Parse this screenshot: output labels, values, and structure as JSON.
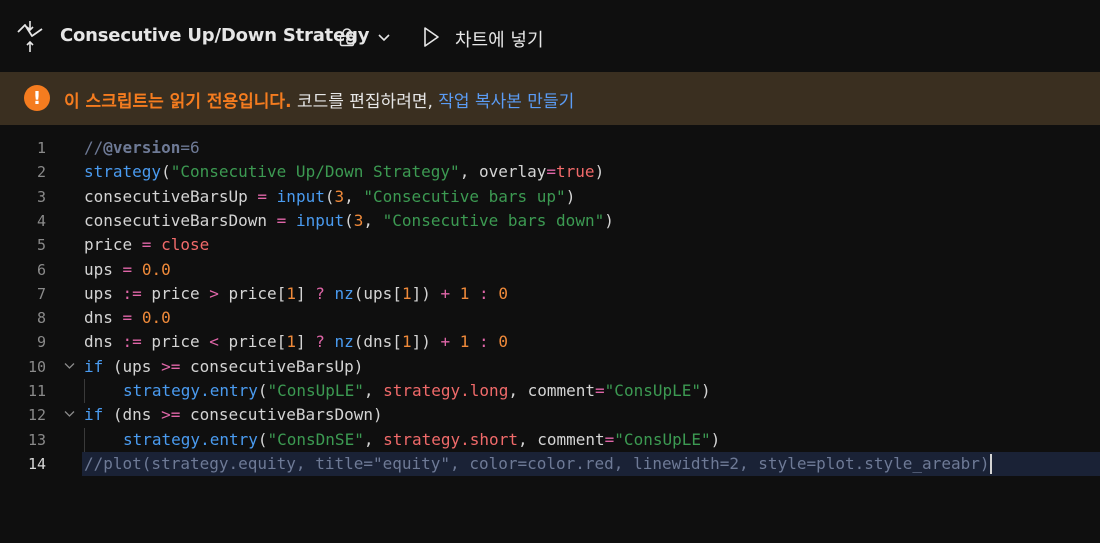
{
  "toolbar": {
    "script_title": "Consecutive Up/Down Strategy",
    "add_to_chart_label": "차트에 넣기",
    "icons": {
      "strategy": "strategy-icon",
      "lock": "lock-icon",
      "dropdown": "chevron-down-icon",
      "play": "play-icon"
    }
  },
  "banner": {
    "icon_glyph": "!",
    "readonly_text": "이 스크립트는 읽기 전용입니다.",
    "edit_text": " 코드를 편집하려면, ",
    "copy_link": "작업 복사본 만들기",
    "colors": {
      "warning": "#f57c1f",
      "link": "#5b9cf5",
      "background": "#3a2f20"
    }
  },
  "editor": {
    "current_line": 14,
    "lines": [
      {
        "n": "1",
        "tokens": [
          [
            "t-cm",
            "//"
          ],
          [
            "t-cmb",
            "@version"
          ],
          [
            "t-cm",
            "=6"
          ]
        ]
      },
      {
        "n": "2",
        "tokens": [
          [
            "t-fn",
            "strategy"
          ],
          [
            "t-var",
            "("
          ],
          [
            "t-str",
            "\"Consecutive Up/Down Strategy\""
          ],
          [
            "t-var",
            ", overlay"
          ],
          [
            "t-op",
            "="
          ],
          [
            "t-bi",
            "true"
          ],
          [
            "t-var",
            ")"
          ]
        ]
      },
      {
        "n": "3",
        "tokens": [
          [
            "t-var",
            "consecutiveBarsUp "
          ],
          [
            "t-op",
            "="
          ],
          [
            "t-var",
            " "
          ],
          [
            "t-fn",
            "input"
          ],
          [
            "t-var",
            "("
          ],
          [
            "t-num",
            "3"
          ],
          [
            "t-var",
            ", "
          ],
          [
            "t-str",
            "\"Consecutive bars up\""
          ],
          [
            "t-var",
            ")"
          ]
        ]
      },
      {
        "n": "4",
        "tokens": [
          [
            "t-var",
            "consecutiveBarsDown "
          ],
          [
            "t-op",
            "="
          ],
          [
            "t-var",
            " "
          ],
          [
            "t-fn",
            "input"
          ],
          [
            "t-var",
            "("
          ],
          [
            "t-num",
            "3"
          ],
          [
            "t-var",
            ", "
          ],
          [
            "t-str",
            "\"Consecutive bars down\""
          ],
          [
            "t-var",
            ")"
          ]
        ]
      },
      {
        "n": "5",
        "tokens": [
          [
            "t-var",
            "price "
          ],
          [
            "t-op",
            "="
          ],
          [
            "t-var",
            " "
          ],
          [
            "t-bi",
            "close"
          ]
        ]
      },
      {
        "n": "6",
        "tokens": [
          [
            "t-var",
            "ups "
          ],
          [
            "t-op",
            "="
          ],
          [
            "t-var",
            " "
          ],
          [
            "t-num",
            "0.0"
          ]
        ]
      },
      {
        "n": "7",
        "tokens": [
          [
            "t-var",
            "ups "
          ],
          [
            "t-op",
            ":="
          ],
          [
            "t-var",
            " price "
          ],
          [
            "t-op",
            ">"
          ],
          [
            "t-var",
            " price["
          ],
          [
            "t-num",
            "1"
          ],
          [
            "t-var",
            "] "
          ],
          [
            "t-op",
            "?"
          ],
          [
            "t-var",
            " "
          ],
          [
            "t-fn",
            "nz"
          ],
          [
            "t-var",
            "(ups["
          ],
          [
            "t-num",
            "1"
          ],
          [
            "t-var",
            "]) "
          ],
          [
            "t-op",
            "+"
          ],
          [
            "t-var",
            " "
          ],
          [
            "t-num",
            "1"
          ],
          [
            "t-var",
            " "
          ],
          [
            "t-op",
            ":"
          ],
          [
            "t-var",
            " "
          ],
          [
            "t-num",
            "0"
          ]
        ]
      },
      {
        "n": "8",
        "tokens": [
          [
            "t-var",
            "dns "
          ],
          [
            "t-op",
            "="
          ],
          [
            "t-var",
            " "
          ],
          [
            "t-num",
            "0.0"
          ]
        ]
      },
      {
        "n": "9",
        "tokens": [
          [
            "t-var",
            "dns "
          ],
          [
            "t-op",
            ":="
          ],
          [
            "t-var",
            " price "
          ],
          [
            "t-op",
            "<"
          ],
          [
            "t-var",
            " price["
          ],
          [
            "t-num",
            "1"
          ],
          [
            "t-var",
            "] "
          ],
          [
            "t-op",
            "?"
          ],
          [
            "t-var",
            " "
          ],
          [
            "t-fn",
            "nz"
          ],
          [
            "t-var",
            "(dns["
          ],
          [
            "t-num",
            "1"
          ],
          [
            "t-var",
            "]) "
          ],
          [
            "t-op",
            "+"
          ],
          [
            "t-var",
            " "
          ],
          [
            "t-num",
            "1"
          ],
          [
            "t-var",
            " "
          ],
          [
            "t-op",
            ":"
          ],
          [
            "t-var",
            " "
          ],
          [
            "t-num",
            "0"
          ]
        ]
      },
      {
        "n": "10",
        "fold": true,
        "tokens": [
          [
            "t-kw",
            "if"
          ],
          [
            "t-var",
            " (ups "
          ],
          [
            "t-op",
            ">="
          ],
          [
            "t-var",
            " consecutiveBarsUp)"
          ]
        ]
      },
      {
        "n": "11",
        "indent": true,
        "tokens": [
          [
            "t-fn",
            "strategy.entry"
          ],
          [
            "t-var",
            "("
          ],
          [
            "t-str",
            "\"ConsUpLE\""
          ],
          [
            "t-var",
            ", "
          ],
          [
            "t-bi",
            "strategy.long"
          ],
          [
            "t-var",
            ", comment"
          ],
          [
            "t-op",
            "="
          ],
          [
            "t-str",
            "\"ConsUpLE\""
          ],
          [
            "t-var",
            ")"
          ]
        ]
      },
      {
        "n": "12",
        "fold": true,
        "tokens": [
          [
            "t-kw",
            "if"
          ],
          [
            "t-var",
            " (dns "
          ],
          [
            "t-op",
            ">="
          ],
          [
            "t-var",
            " consecutiveBarsDown)"
          ]
        ]
      },
      {
        "n": "13",
        "indent": true,
        "tokens": [
          [
            "t-fn",
            "strategy.entry"
          ],
          [
            "t-var",
            "("
          ],
          [
            "t-str",
            "\"ConsDnSE\""
          ],
          [
            "t-var",
            ", "
          ],
          [
            "t-bi",
            "strategy.short"
          ],
          [
            "t-var",
            ", comment"
          ],
          [
            "t-op",
            "="
          ],
          [
            "t-str",
            "\"ConsUpLE\""
          ],
          [
            "t-var",
            ")"
          ]
        ]
      },
      {
        "n": "14",
        "tokens": [
          [
            "t-cm",
            "//plot(strategy.equity, title=\"equity\", color=color.red, linewidth=2, style=plot.style_areabr)"
          ]
        ]
      }
    ]
  }
}
